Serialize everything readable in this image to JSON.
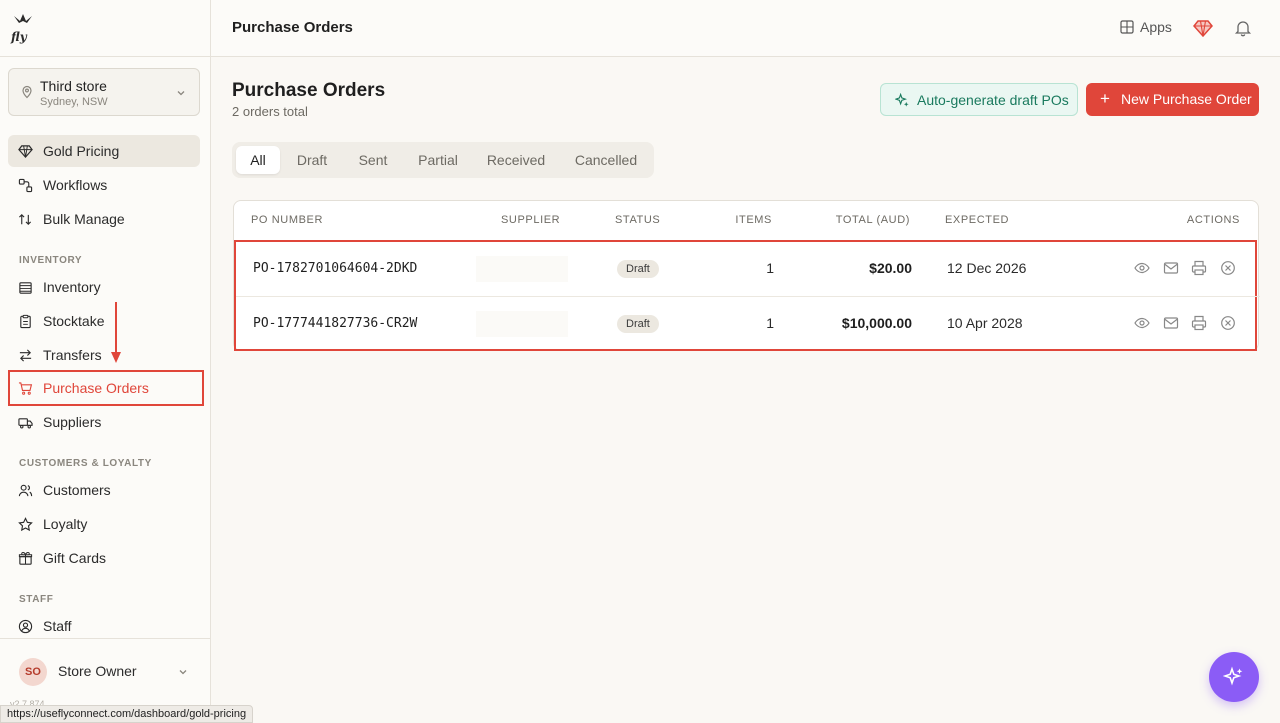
{
  "topbar": {
    "title": "Purchase Orders",
    "apps_label": "Apps"
  },
  "sidebar": {
    "store": {
      "name": "Third store",
      "location": "Sydney, NSW"
    },
    "items_top": [
      {
        "label": "Gold Pricing",
        "icon": "gem-icon",
        "active": true
      },
      {
        "label": "Workflows",
        "icon": "workflow-icon"
      },
      {
        "label": "Bulk Manage",
        "icon": "sort-icon"
      }
    ],
    "sections": [
      {
        "title": "INVENTORY",
        "items": [
          {
            "label": "Inventory",
            "icon": "inventory-icon"
          },
          {
            "label": "Stocktake",
            "icon": "clipboard-icon"
          },
          {
            "label": "Transfers",
            "icon": "transfer-icon"
          },
          {
            "label": "Purchase Orders",
            "icon": "cart-icon",
            "highlighted": true
          },
          {
            "label": "Suppliers",
            "icon": "truck-icon"
          }
        ]
      },
      {
        "title": "CUSTOMERS & LOYALTY",
        "items": [
          {
            "label": "Customers",
            "icon": "users-icon"
          },
          {
            "label": "Loyalty",
            "icon": "star-icon"
          },
          {
            "label": "Gift Cards",
            "icon": "gift-icon"
          }
        ]
      },
      {
        "title": "STAFF",
        "items": [
          {
            "label": "Staff",
            "icon": "user-circle-icon"
          }
        ]
      }
    ],
    "user": {
      "initials": "SO",
      "name": "Store Owner"
    },
    "version": "v2.7.874"
  },
  "status_url": "https://useflyconnect.com/dashboard/gold-pricing",
  "main": {
    "title": "Purchase Orders",
    "subtitle": "2 orders total",
    "auto_button": "Auto-generate draft POs",
    "new_button": "New Purchase Order",
    "tabs": [
      "All",
      "Draft",
      "Sent",
      "Partial",
      "Received",
      "Cancelled"
    ],
    "active_tab": "All",
    "table": {
      "headers": [
        "PO NUMBER",
        "SUPPLIER",
        "STATUS",
        "ITEMS",
        "TOTAL (AUD)",
        "EXPECTED",
        "ACTIONS"
      ],
      "rows": [
        {
          "po": "PO-1782701064604-2DKD",
          "supplier": "",
          "status": "Draft",
          "items": "1",
          "total": "$20.00",
          "expected": "12 Dec 2026"
        },
        {
          "po": "PO-1777441827736-CR2W",
          "supplier": "",
          "status": "Draft",
          "items": "1",
          "total": "$10,000.00",
          "expected": "10 Apr 2028"
        }
      ]
    }
  },
  "colors": {
    "accent": "#e0463a",
    "teal": "#1a7a5e",
    "fab": "#8b5cf6"
  }
}
